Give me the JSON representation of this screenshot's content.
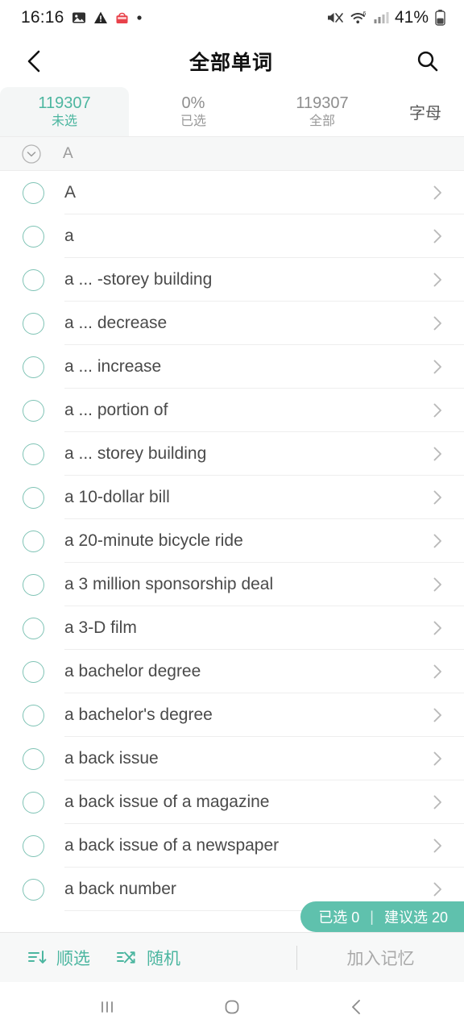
{
  "status_bar": {
    "time": "16:16",
    "battery_percent": "41%",
    "icons": [
      "image-icon",
      "warning-triangle-icon",
      "shopping-app-icon",
      "dot-icon",
      "mute-icon",
      "wifi-icon",
      "signal-bars-icon",
      "battery-icon"
    ]
  },
  "app_bar": {
    "title": "全部单词",
    "back_icon": "chevron-left-icon",
    "search_icon": "search-icon"
  },
  "tabs": {
    "items": [
      {
        "number": "119307",
        "label": "未选",
        "active": true
      },
      {
        "number": "0%",
        "label": "已选",
        "active": false
      },
      {
        "number": "119307",
        "label": "全部",
        "active": false
      }
    ],
    "letter_button": "字母"
  },
  "section": {
    "collapse_icon": "chevron-down-circle-icon",
    "label": "A"
  },
  "list": {
    "rows": [
      {
        "word": "A"
      },
      {
        "word": "a"
      },
      {
        "word": "a ... -storey building"
      },
      {
        "word": "a ... decrease"
      },
      {
        "word": "a ... increase"
      },
      {
        "word": "a ... portion of"
      },
      {
        "word": "a ... storey building"
      },
      {
        "word": "a 10-dollar bill"
      },
      {
        "word": "a 20-minute bicycle ride"
      },
      {
        "word": "a 3 million sponsorship deal"
      },
      {
        "word": "a 3-D film"
      },
      {
        "word": "a bachelor degree"
      },
      {
        "word": "a bachelor's degree"
      },
      {
        "word": "a back issue"
      },
      {
        "word": "a back issue of a magazine"
      },
      {
        "word": "a back issue of a newspaper"
      },
      {
        "word": "a back number"
      }
    ],
    "row_chevron_icon": "chevron-right-icon"
  },
  "selection_badge": {
    "selected_text": "已选 0",
    "separator": "|",
    "suggested_text": "建议选 20"
  },
  "toolbar": {
    "sort_label": "顺选",
    "sort_icon": "sort-descending-icon",
    "random_label": "随机",
    "random_icon": "shuffle-icon",
    "memory_label": "加入记忆"
  },
  "nav_bar": {
    "recents_icon": "recents-icon",
    "home_icon": "home-icon",
    "back_icon": "back-icon"
  },
  "colors": {
    "accent": "#4cb6a0",
    "badge": "#5fc1ad",
    "circle_border": "#7fc3b5",
    "text_primary": "#4a4a4a",
    "text_muted": "#9a9a9a"
  }
}
